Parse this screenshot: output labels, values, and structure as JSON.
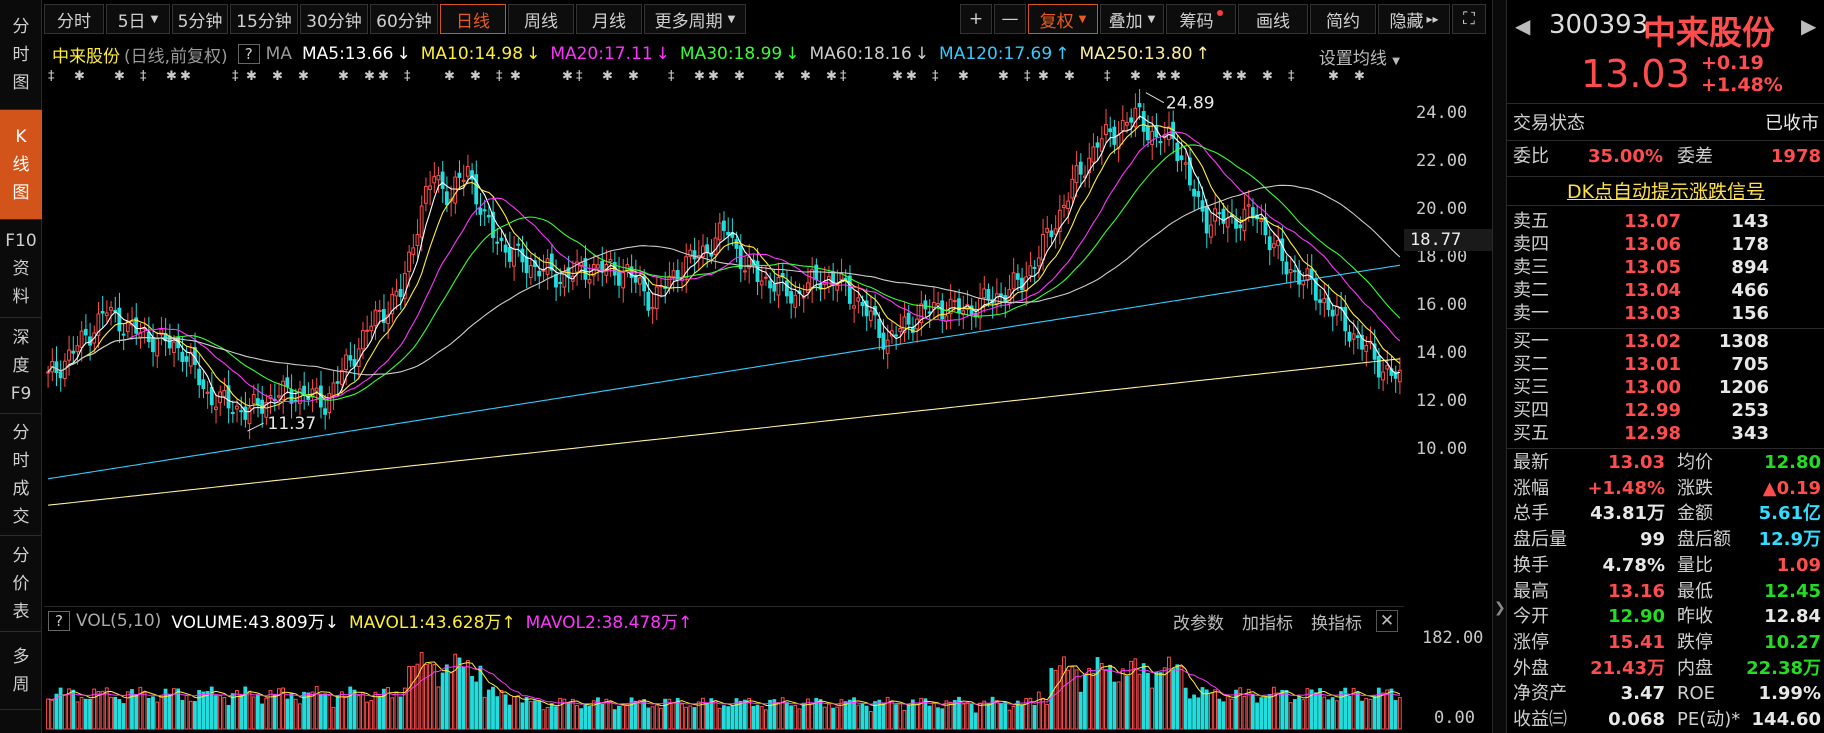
{
  "left_nav": [
    {
      "label_lines": [
        "分",
        "时",
        "图"
      ],
      "active": false
    },
    {
      "label_lines": [
        "K",
        "线",
        "图"
      ],
      "active": true
    },
    {
      "label_lines": [
        "F10",
        "资",
        "料"
      ],
      "active": false
    },
    {
      "label_lines": [
        "深",
        "度",
        "F9"
      ],
      "active": false
    },
    {
      "label_lines": [
        "分",
        "时",
        "成",
        "交"
      ],
      "active": false
    },
    {
      "label_lines": [
        "分",
        "价",
        "表"
      ],
      "active": false
    },
    {
      "label_lines": [
        "多",
        "周"
      ],
      "active": false
    }
  ],
  "toolbar": {
    "periods": [
      "分时",
      "5日",
      "5分钟",
      "15分钟",
      "30分钟",
      "60分钟",
      "日线",
      "周线",
      "月线",
      "更多周期"
    ],
    "active_period": "日线",
    "zoom_in": "+",
    "zoom_out": "—",
    "fuquan": "复权",
    "overlay": "叠加",
    "chips": "筹码",
    "draw": "画线",
    "simple": "简约",
    "hide": "隐藏",
    "hide_arrows": "▸▸",
    "fullscreen_icon": "⛶"
  },
  "ma_bar": {
    "stock": "中来股份",
    "mode": "(日线,前复权)",
    "help": "?",
    "ma_label": "MA",
    "items": [
      {
        "text": "MA5:13.66",
        "arrow": "↓",
        "color": "#ffffff"
      },
      {
        "text": "MA10:14.98",
        "arrow": "↓",
        "color": "#ffee33"
      },
      {
        "text": "MA20:17.11",
        "arrow": "↓",
        "color": "#ff33ff"
      },
      {
        "text": "MA30:18.99",
        "arrow": "↓",
        "color": "#33ff33"
      },
      {
        "text": "MA60:18.16",
        "arrow": "↓",
        "color": "#cccccc"
      },
      {
        "text": "MA120:17.69",
        "arrow": "↑",
        "color": "#33ccff"
      },
      {
        "text": "MA250:13.80",
        "arrow": "↑",
        "color": "#ffee99"
      }
    ],
    "settings": "设置均线"
  },
  "price_axis": {
    "labels": [
      "24.00",
      "22.00",
      "20.00",
      "18.00",
      "16.00",
      "14.00",
      "12.00",
      "10.00"
    ],
    "current": "18.77"
  },
  "annotations": {
    "high_label": "24.89",
    "low_label": "11.37"
  },
  "volume": {
    "help": "?",
    "title": "VOL(5,10)",
    "volume": "VOLUME:43.809万",
    "volume_arrow": "↓",
    "mavol1": "MAVOL1:43.628万",
    "mavol1_arrow": "↑",
    "mavol2": "MAVOL2:38.478万",
    "mavol2_arrow": "↑",
    "tools": [
      "改参数",
      "加指标",
      "换指标"
    ],
    "close": "✕",
    "axis_top": "182.00",
    "axis_bottom": "0.00"
  },
  "colors": {
    "up": "#ff4d4d",
    "down": "#22dddd",
    "active": "#d2541a"
  },
  "quote": {
    "code": "300393",
    "name": "中来股份",
    "price": "13.03",
    "change": "+0.19",
    "change_pct": "+1.48%",
    "nav_prev": "◀",
    "nav_next": "▶",
    "trade_status_label": "交易状态",
    "trade_status": "已收市",
    "weibi_label": "委比",
    "weibi": "35.00%",
    "weicha_label": "委差",
    "weicha": "1978",
    "dk_banner": "DK点自动提示涨跌信号",
    "sell": [
      {
        "label": "卖五",
        "price": "13.07",
        "vol": "143"
      },
      {
        "label": "卖四",
        "price": "13.06",
        "vol": "178"
      },
      {
        "label": "卖三",
        "price": "13.05",
        "vol": "894"
      },
      {
        "label": "卖二",
        "price": "13.04",
        "vol": "466"
      },
      {
        "label": "卖一",
        "price": "13.03",
        "vol": "156"
      }
    ],
    "buy": [
      {
        "label": "买一",
        "price": "13.02",
        "vol": "1308"
      },
      {
        "label": "买二",
        "price": "13.01",
        "vol": "705"
      },
      {
        "label": "买三",
        "price": "13.00",
        "vol": "1206"
      },
      {
        "label": "买四",
        "price": "12.99",
        "vol": "253"
      },
      {
        "label": "买五",
        "price": "12.98",
        "vol": "343"
      }
    ],
    "stats": [
      {
        "k1": "最新",
        "v1": "13.03",
        "c1": "red",
        "k2": "均价",
        "v2": "12.80",
        "c2": "green"
      },
      {
        "k1": "涨幅",
        "v1": "+1.48%",
        "c1": "red",
        "k2": "涨跌",
        "v2": "▲0.19",
        "c2": "red"
      },
      {
        "k1": "总手",
        "v1": "43.81万",
        "c1": "white",
        "k2": "金额",
        "v2": "5.61亿",
        "c2": "cyan"
      },
      {
        "k1": "盘后量",
        "v1": "99",
        "c1": "white",
        "k2": "盘后额",
        "v2": "12.9万",
        "c2": "cyan"
      },
      {
        "k1": "换手",
        "v1": "4.78%",
        "c1": "white",
        "k2": "量比",
        "v2": "1.09",
        "c2": "red"
      },
      {
        "k1": "最高",
        "v1": "13.16",
        "c1": "red",
        "k2": "最低",
        "v2": "12.45",
        "c2": "green"
      },
      {
        "k1": "今开",
        "v1": "12.90",
        "c1": "green",
        "k2": "昨收",
        "v2": "12.84",
        "c2": "white"
      },
      {
        "k1": "涨停",
        "v1": "15.41",
        "c1": "red",
        "k2": "跌停",
        "v2": "10.27",
        "c2": "green"
      },
      {
        "k1": "外盘",
        "v1": "21.43万",
        "c1": "red",
        "k2": "内盘",
        "v2": "22.38万",
        "c2": "green"
      },
      {
        "k1": "净资产",
        "v1": "3.47",
        "c1": "white",
        "k2": "ROE",
        "v2": "1.99%",
        "c2": "white"
      },
      {
        "k1": "收益㈢",
        "v1": "0.068",
        "c1": "white",
        "k2": "PE(动)*",
        "v2": "144.60",
        "c2": "white"
      }
    ]
  }
}
